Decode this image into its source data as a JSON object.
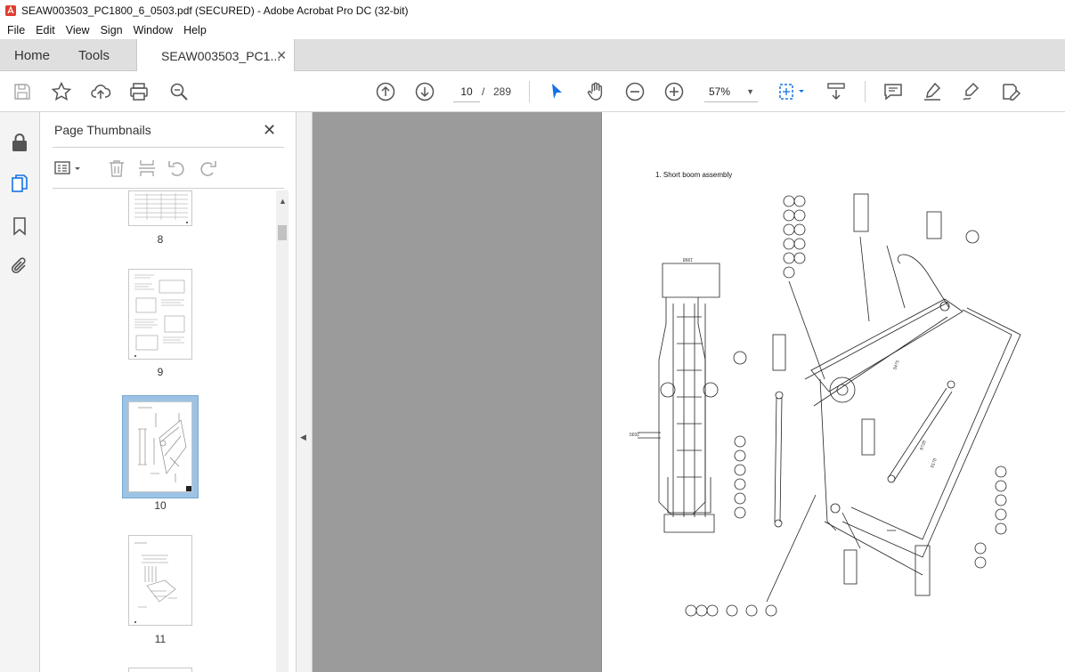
{
  "window": {
    "title": "SEAW003503_PC1800_6_0503.pdf (SECURED) - Adobe Acrobat Pro DC (32-bit)"
  },
  "menu": [
    "File",
    "Edit",
    "View",
    "Sign",
    "Window",
    "Help"
  ],
  "tabs": {
    "home": "Home",
    "tools": "Tools",
    "document": "SEAW003503_PC1..."
  },
  "toolbar": {
    "current_page": "10",
    "separator": "/",
    "total_pages": "289",
    "zoom": "57%"
  },
  "panel": {
    "title": "Page Thumbnails",
    "thumbnails": [
      {
        "label": "8"
      },
      {
        "label": "9"
      },
      {
        "label": "10",
        "selected": true
      },
      {
        "label": "11"
      }
    ]
  },
  "document_page": {
    "heading": "1. Short boom assembly"
  },
  "colors": {
    "accent_blue": "#1473e6",
    "selection": "#9cc3e5",
    "tab_bar": "#dfdfdf",
    "canvas": "#9b9b9b"
  }
}
